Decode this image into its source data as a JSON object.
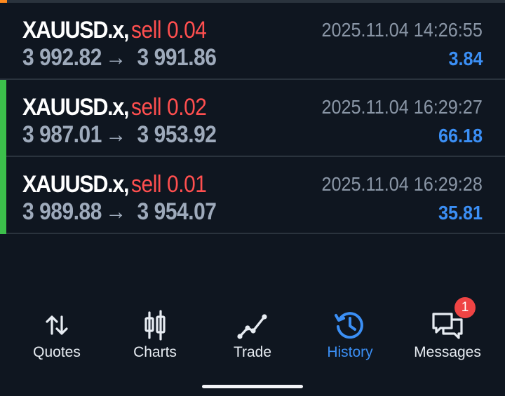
{
  "trades": [
    {
      "symbol": "XAUUSD.x",
      "side": "sell",
      "volume": "0.04",
      "open_price": "3 992.82",
      "close_price": "3 991.86",
      "time": "2025.11.04 14:26:55",
      "profit": "3.84"
    },
    {
      "symbol": "XAUUSD.x",
      "side": "sell",
      "volume": "0.02",
      "open_price": "3 987.01",
      "close_price": "3 953.92",
      "time": "2025.11.04 16:29:27",
      "profit": "66.18"
    },
    {
      "symbol": "XAUUSD.x",
      "side": "sell",
      "volume": "0.01",
      "open_price": "3 989.88",
      "close_price": "3 954.07",
      "time": "2025.11.04 16:29:28",
      "profit": "35.81"
    }
  ],
  "price_arrow": "→",
  "nav": {
    "items": [
      {
        "label": "Quotes",
        "icon": "quotes-arrows-icon"
      },
      {
        "label": "Charts",
        "icon": "candlesticks-icon"
      },
      {
        "label": "Trade",
        "icon": "trade-line-icon"
      },
      {
        "label": "History",
        "icon": "history-clock-icon"
      },
      {
        "label": "Messages",
        "icon": "messages-icon",
        "badge": "1"
      }
    ],
    "active": "History"
  },
  "colors": {
    "background": "#0f1620",
    "sell": "#ff4f4f",
    "profit": "#3b8ff5",
    "active": "#3b8ff5",
    "badge": "#ef4444",
    "marker": "#3cbf4b"
  }
}
